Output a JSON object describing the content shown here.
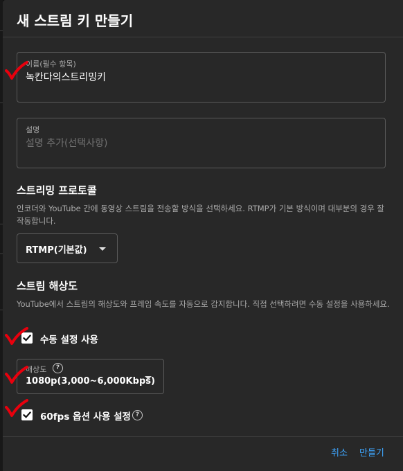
{
  "dialog": {
    "title": "새 스트림 키 만들기"
  },
  "name_field": {
    "label": "이름(필수 항목)",
    "value": "녹칸다의스트리밍키"
  },
  "description_field": {
    "label": "설명",
    "placeholder": "설명 추가(선택사항)"
  },
  "protocol": {
    "title": "스트리밍 프로토콜",
    "description": "인코더와 YouTube 간에 동영상 스트림을 전송할 방식을 선택하세요. RTMP가 기본 방식이며 대부분의 경우 잘 작동합니다.",
    "selected": "RTMP(기본값)"
  },
  "resolution": {
    "title": "스트림 해상도",
    "description": "YouTube에서 스트림의 해상도와 프레임 속도를 자동으로 감지합니다. 직접 선택하려면 수동 설정을 사용하세요.",
    "manual_checkbox": {
      "label": "수동 설정 사용",
      "checked": true
    },
    "resolution_select": {
      "label": "해상도",
      "help": "?",
      "value": "1080p(3,000~6,000Kbps)"
    },
    "fps_checkbox": {
      "label": "60fps 옵션 사용 설정",
      "checked": true,
      "help": "?"
    }
  },
  "footer": {
    "cancel_label": "취소",
    "create_label": "만들기"
  },
  "colors": {
    "dialog_bg": "#282828",
    "accent": "#3ea6ff",
    "annotation": "#e8000d"
  },
  "icons": {
    "checkbox": "check-icon",
    "dropdown": "chevron-down-icon",
    "help": "help-circle-icon",
    "annotation": "red-checkmark-icon"
  }
}
